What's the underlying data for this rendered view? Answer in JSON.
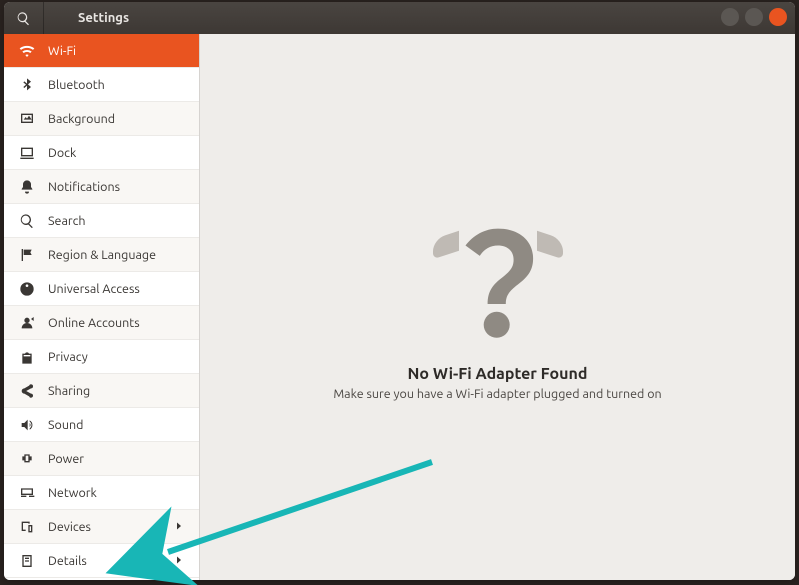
{
  "window": {
    "title": "Settings"
  },
  "sidebar": {
    "items": [
      {
        "label": "Wi-Fi",
        "icon": "wifi-icon",
        "selected": true
      },
      {
        "label": "Bluetooth",
        "icon": "bluetooth-icon"
      },
      {
        "label": "Background",
        "icon": "background-icon"
      },
      {
        "label": "Dock",
        "icon": "dock-icon"
      },
      {
        "label": "Notifications",
        "icon": "bell-icon"
      },
      {
        "label": "Search",
        "icon": "search-icon"
      },
      {
        "label": "Region & Language",
        "icon": "flag-icon"
      },
      {
        "label": "Universal Access",
        "icon": "accessibility-icon"
      },
      {
        "label": "Online Accounts",
        "icon": "accounts-icon"
      },
      {
        "label": "Privacy",
        "icon": "privacy-icon"
      },
      {
        "label": "Sharing",
        "icon": "sharing-icon"
      },
      {
        "label": "Sound",
        "icon": "sound-icon"
      },
      {
        "label": "Power",
        "icon": "power-icon"
      },
      {
        "label": "Network",
        "icon": "network-icon"
      },
      {
        "label": "Devices",
        "icon": "devices-icon",
        "chevron": true
      },
      {
        "label": "Details",
        "icon": "details-icon",
        "chevron": true
      }
    ]
  },
  "content": {
    "title": "No Wi-Fi Adapter Found",
    "subtitle": "Make sure you have a Wi-Fi adapter plugged and turned on"
  },
  "annotation": {
    "type": "arrow",
    "color": "#18b6b6"
  }
}
